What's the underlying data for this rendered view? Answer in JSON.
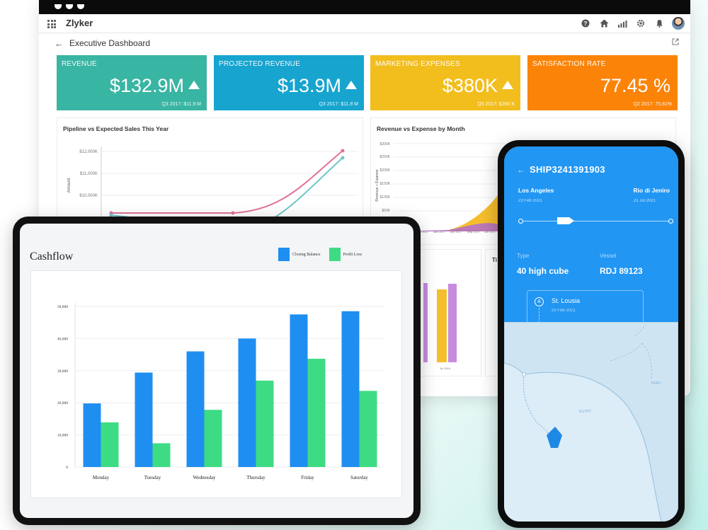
{
  "dashboard": {
    "app_name": "Zlyker",
    "title": "Executive Dashboard",
    "kpis": [
      {
        "label": "REVENUE",
        "value": "$132.9M",
        "sub": "Q3 2017: $11.9 M",
        "color": "#39b5a3",
        "trend": "up"
      },
      {
        "label": "PROJECTED REVENUE",
        "value": "$13.9M",
        "sub": "Q3 2017: $11.8 M",
        "color": "#17a4cf",
        "trend": "up"
      },
      {
        "label": "MARKETING EXPENSES",
        "value": "$380K",
        "sub": "Q3 2017: $280 K",
        "color": "#f2be1e",
        "trend": "up"
      },
      {
        "label": "SATISFACTION RATE",
        "value": "77.45 %",
        "sub": "Q2 2017: 75.81%",
        "color": "#fb8408",
        "trend": "none"
      }
    ],
    "pipeline_title": "Pipeline vs Expected Sales This Year",
    "pipeline_ylabel": "Amount",
    "pipeline_ticks": [
      "$12,000K",
      "$11,000K",
      "$10,000K"
    ],
    "revexp_title": "Revenue vs Expense by Month",
    "revexp_ylabel": "Revenue + Expense",
    "revexp_ticks": [
      "$300K",
      "$250K",
      "$200K",
      "$150K",
      "$100K",
      "$50K"
    ],
    "revexp_xticks": [
      "Jan 2017",
      "Feb 2017",
      "Mar 2017",
      "Apr 2017",
      "May 2017",
      "Jun 2017",
      "Jul 2017"
    ],
    "lower_xtick": "Jul 2016",
    "lower_panel_b_title": "Ti"
  },
  "cashflow": {
    "title": "Cashflow",
    "legend": {
      "closing": "Closing Balance",
      "profit": "Profit Loss"
    },
    "colors": {
      "closing": "#1f8ef1",
      "profit": "#3ddc84"
    }
  },
  "chart_data": {
    "type": "bar",
    "categories": [
      "Monday",
      "Tuesday",
      "Wednesday",
      "Thursday",
      "Friday",
      "Saturday"
    ],
    "series": [
      {
        "name": "Closing Balance",
        "values": [
          19800,
          29400,
          36000,
          40000,
          47500,
          48500
        ]
      },
      {
        "name": "Profit Loss",
        "values": [
          13900,
          7400,
          17800,
          26900,
          33700,
          23700
        ]
      }
    ],
    "ylim": [
      0,
      50000
    ],
    "yticks": [
      "50,000",
      "40,000",
      "30,000",
      "20,000",
      "10,000",
      "0"
    ],
    "grid": true,
    "legend_position": "top-right"
  },
  "shipment": {
    "id": "SHIP3241391903",
    "origin": {
      "city": "Los Angeles",
      "date": "23 Feb 2021"
    },
    "destination": {
      "city": "Rio di Jeniro",
      "date": "21 Jul 2021"
    },
    "progress": 0.3,
    "type_label": "Type",
    "type_value": "40 high cube",
    "vessel_label": "Vessel",
    "vessel_value": "RDJ 89123",
    "stop": {
      "marker": "A",
      "name": "St. Lousia",
      "date": "25 Feb 2021"
    },
    "map_labels": [
      "EGYPT",
      "PERU"
    ]
  }
}
